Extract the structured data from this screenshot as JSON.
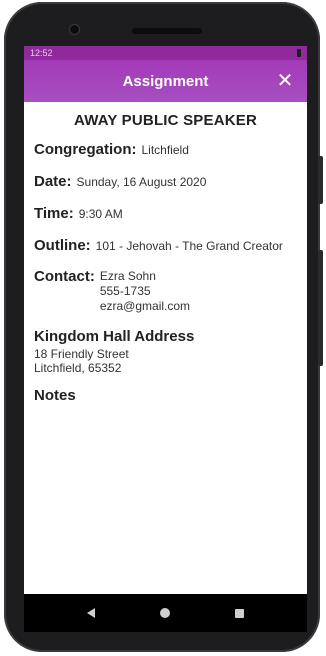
{
  "status": {
    "time": "12:52"
  },
  "appbar": {
    "title": "Assignment",
    "close_icon": "close-icon"
  },
  "main": {
    "heading": "AWAY PUBLIC SPEAKER",
    "congregation": {
      "label": "Congregation:",
      "value": "Litchfield"
    },
    "date": {
      "label": "Date:",
      "value": "Sunday, 16 August 2020"
    },
    "time": {
      "label": "Time:",
      "value": "9:30 AM"
    },
    "outline": {
      "label": "Outline:",
      "value": "101 - Jehovah - The Grand Creator"
    },
    "contact": {
      "label": "Contact:",
      "name": "Ezra Sohn",
      "phone": "555-1735",
      "email": "ezra@gmail.com"
    },
    "kingdom_hall": {
      "title": "Kingdom Hall Address",
      "line1": "18 Friendly Street",
      "line2": "Litchfield, 65352"
    },
    "notes": {
      "title": "Notes"
    }
  },
  "navbar": {
    "back_icon": "back-icon",
    "home_icon": "home-icon",
    "recents_icon": "recents-icon"
  },
  "colors": {
    "appbar": "#a33ab8",
    "statusbar": "#8e2a9b"
  }
}
